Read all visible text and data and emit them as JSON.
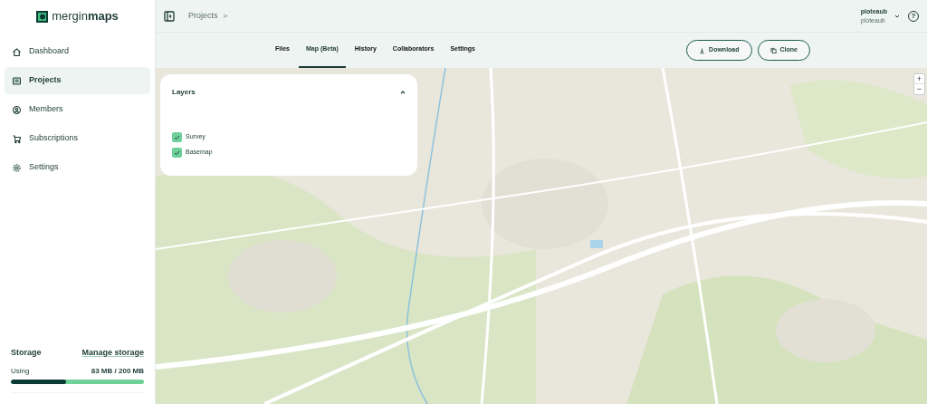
{
  "logo": {
    "text_light": "mergin",
    "text_bold": "maps"
  },
  "sidebar": {
    "items": [
      {
        "label": "Dashboard",
        "selected": false
      },
      {
        "label": "Projects",
        "selected": true
      },
      {
        "label": "Members",
        "selected": false
      },
      {
        "label": "Subscriptions",
        "selected": false
      },
      {
        "label": "Settings",
        "selected": false
      }
    ]
  },
  "storage": {
    "title": "Storage",
    "link": "Manage storage",
    "using_label": "Using",
    "reading": "83 MB / 200 MB",
    "level": 0.415
  },
  "header": {
    "breadcrumb": "Projects",
    "separator": ">",
    "user_name": "ploteaub",
    "user_workspace": "ploteaub",
    "help": "?"
  },
  "tabs": [
    {
      "label": "Files",
      "selected": false
    },
    {
      "label": "Map (Beta)",
      "selected": true
    },
    {
      "label": "History",
      "selected": false
    },
    {
      "label": "Collaborators",
      "selected": false
    },
    {
      "label": "Settings",
      "selected": false
    }
  ],
  "actions": [
    {
      "label": "Download"
    },
    {
      "label": "Clone"
    }
  ],
  "layers_panel": {
    "title": "Layers",
    "expanded": true,
    "layers": [
      {
        "label": "Survey",
        "checked": true
      },
      {
        "label": "Basemap",
        "checked": true
      }
    ]
  },
  "map": {
    "zoom_in": "+",
    "zoom_out": "−"
  }
}
